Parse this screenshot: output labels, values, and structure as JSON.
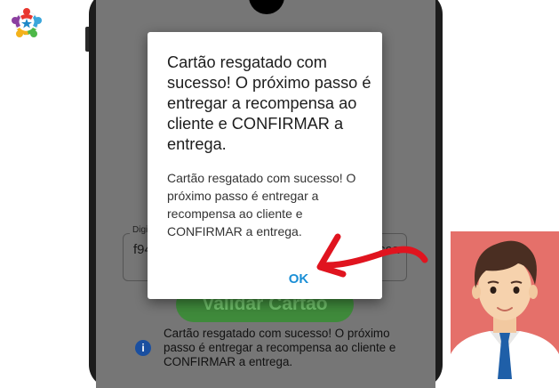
{
  "colors": {
    "ok_button": "#1b8fd6",
    "validate_button": "#3f8a3b",
    "arrow": "#e0141f",
    "avatar_background": "#e5706a",
    "info_icon": "#1a4fa0"
  },
  "icons": {
    "logo": "community-people-logo",
    "info": "info-icon",
    "arrow": "red-arrow-pointer",
    "avatar": "user-avatar"
  },
  "app": {
    "code_input": {
      "label": "Digi",
      "value_left": "f94",
      "value_right": "cca"
    },
    "validate_button_label": "Validar Cartão",
    "info_message": "Cartão resgatado com sucesso! O próximo passo é entregar a recompensa ao cliente e CONFIRMAR a entrega."
  },
  "dialog": {
    "title": "Cartão resgatado com sucesso! O próximo passo é entregar a recompensa ao cliente e CONFIRMAR a entrega.",
    "message": "Cartão resgatado com sucesso! O próximo passo é entregar a recompensa ao cliente e CONFIRMAR a entrega.",
    "ok_label": "OK"
  }
}
